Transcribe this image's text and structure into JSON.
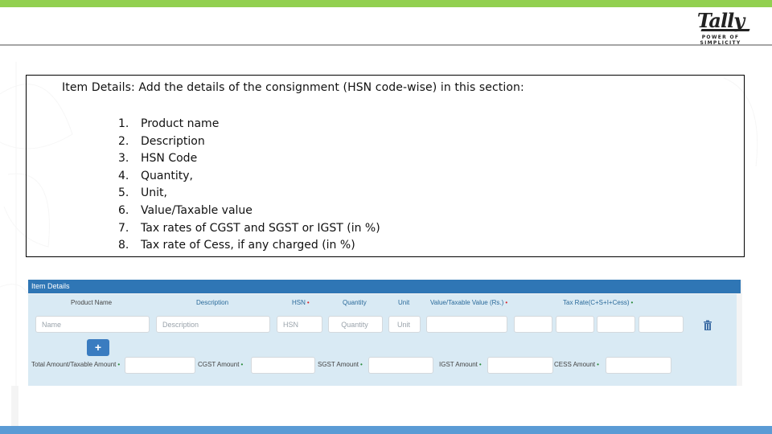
{
  "header": {
    "logo_word": "Tally",
    "logo_tagline": "POWER OF SIMPLICITY"
  },
  "colors": {
    "top_bar": "#92d050",
    "bottom_bar": "#5b9bd5",
    "panel_header": "#2f76b5",
    "panel_body": "#d9eaf4",
    "add_button": "#3a7cc0"
  },
  "content": {
    "intro": "Item Details: Add the details of the consignment (HSN code-wise) in this section:",
    "items": [
      {
        "num": "1.",
        "text": "Product name"
      },
      {
        "num": "2.",
        "text": "Description"
      },
      {
        "num": "3.",
        "text": "HSN Code"
      },
      {
        "num": "4.",
        "text": "Quantity,"
      },
      {
        "num": "5.",
        "text": "Unit,"
      },
      {
        "num": "6.",
        "text": "Value/Taxable value"
      },
      {
        "num": "7.",
        "text": "Tax rates of CGST and SGST or IGST (in %)"
      },
      {
        "num": "8.",
        "text": "Tax rate of Cess, if any charged (in %)"
      }
    ]
  },
  "form": {
    "title": "Item Details",
    "columns": {
      "product_name": "Product Name",
      "description": "Description",
      "hsn": "HSN",
      "quantity": "Quantity",
      "unit": "Unit",
      "value": "Value/Taxable Value (Rs.)",
      "tax_rate": "Tax Rate(C+S+I+Cess)"
    },
    "required_marker": "•",
    "placeholders": {
      "name": "Name",
      "description": "Description",
      "hsn": "HSN",
      "quantity": "Quantity",
      "unit": "Unit"
    },
    "add_button": "+",
    "totals": {
      "total_label": "Total Amount/Taxable Amount",
      "cgst_label": "CGST Amount",
      "sgst_label": "SGST Amount",
      "igst_label": "IGST Amount",
      "cess_label": "CESS Amount"
    }
  }
}
